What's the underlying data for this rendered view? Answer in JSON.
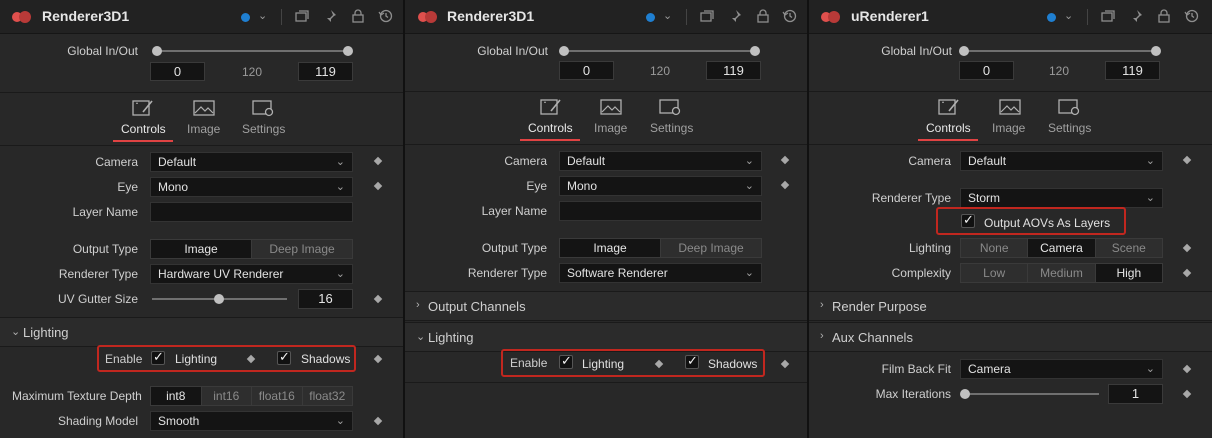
{
  "panels": [
    {
      "title": "Renderer3D1",
      "global_inout": {
        "label": "Global In/Out",
        "start": "0",
        "mid": "120",
        "end": "119"
      },
      "tabs": [
        {
          "label": "Controls"
        },
        {
          "label": "Image"
        },
        {
          "label": "Settings"
        }
      ],
      "camera": {
        "label": "Camera",
        "value": "Default"
      },
      "eye": {
        "label": "Eye",
        "value": "Mono"
      },
      "layer_name": {
        "label": "Layer Name",
        "value": ""
      },
      "output_type": {
        "label": "Output Type",
        "options": [
          "Image",
          "Deep Image"
        ],
        "selected": "Image"
      },
      "renderer_type": {
        "label": "Renderer Type",
        "value": "Hardware UV Renderer"
      },
      "uv_gutter": {
        "label": "UV Gutter Size",
        "value": "16"
      },
      "lighting_section": {
        "title": "Lighting"
      },
      "enable": {
        "label": "Enable",
        "lighting_label": "Lighting",
        "shadows_label": "Shadows"
      },
      "texture_depth": {
        "label": "Maximum Texture Depth",
        "options": [
          "int8",
          "int16",
          "float16",
          "float32"
        ],
        "selected": "int8"
      },
      "shading_model": {
        "label": "Shading Model",
        "value": "Smooth"
      }
    },
    {
      "title": "Renderer3D1",
      "global_inout": {
        "label": "Global In/Out",
        "start": "0",
        "mid": "120",
        "end": "119"
      },
      "tabs": [
        {
          "label": "Controls"
        },
        {
          "label": "Image"
        },
        {
          "label": "Settings"
        }
      ],
      "camera": {
        "label": "Camera",
        "value": "Default"
      },
      "eye": {
        "label": "Eye",
        "value": "Mono"
      },
      "layer_name": {
        "label": "Layer Name",
        "value": ""
      },
      "output_type": {
        "label": "Output Type",
        "options": [
          "Image",
          "Deep Image"
        ],
        "selected": "Image"
      },
      "renderer_type": {
        "label": "Renderer Type",
        "value": "Software Renderer"
      },
      "output_channels": {
        "title": "Output Channels"
      },
      "lighting_section": {
        "title": "Lighting"
      },
      "enable": {
        "label": "Enable",
        "lighting_label": "Lighting",
        "shadows_label": "Shadows"
      }
    },
    {
      "title": "uRenderer1",
      "global_inout": {
        "label": "Global In/Out",
        "start": "0",
        "mid": "120",
        "end": "119"
      },
      "tabs": [
        {
          "label": "Controls"
        },
        {
          "label": "Image"
        },
        {
          "label": "Settings"
        }
      ],
      "camera": {
        "label": "Camera",
        "value": "Default"
      },
      "renderer_type": {
        "label": "Renderer Type",
        "value": "Storm"
      },
      "output_aovs": {
        "label": "Output AOVs As Layers"
      },
      "lighting": {
        "label": "Lighting",
        "options": [
          "None",
          "Camera",
          "Scene"
        ],
        "selected": "Camera"
      },
      "complexity": {
        "label": "Complexity",
        "options": [
          "Low",
          "Medium",
          "High"
        ],
        "selected": "High"
      },
      "render_purpose": {
        "title": "Render Purpose"
      },
      "aux_channels": {
        "title": "Aux Channels"
      },
      "film_back_fit": {
        "label": "Film Back Fit",
        "value": "Camera"
      },
      "max_iterations": {
        "label": "Max Iterations",
        "value": "1"
      }
    }
  ],
  "colors": {
    "accent_red": "#e04343",
    "highlight_box": "#c1271f",
    "node_blue": "#1f7fd1"
  }
}
